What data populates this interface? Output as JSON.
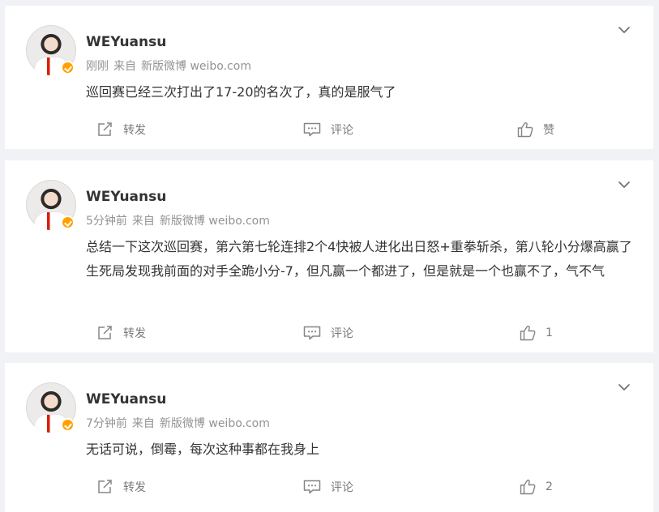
{
  "posts": [
    {
      "name": "WEYuansu",
      "time": "刚刚",
      "source_prefix": "来自",
      "source": "新版微博 weibo.com",
      "text": "巡回赛已经三次打出了17-20的名次了，真的是服气了",
      "repost_label": "转发",
      "comment_label": "评论",
      "like_label": "赞"
    },
    {
      "name": "WEYuansu",
      "time": "5分钟前",
      "source_prefix": "来自",
      "source": "新版微博 weibo.com",
      "text": "总结一下这次巡回赛，第六第七轮连排2个4快被人进化出日怒+重拳斩杀，第八轮小分爆高赢了生死局发现我前面的对手全跪小分-7，但凡赢一个都进了，但是就是一个也赢不了，气不气",
      "repost_label": "转发",
      "comment_label": "评论",
      "like_label": "1"
    },
    {
      "name": "WEYuansu",
      "time": "7分钟前",
      "source_prefix": "来自",
      "source": "新版微博 weibo.com",
      "text": "无话可说，倒霉，每次这种事都在我身上",
      "repost_label": "转发",
      "comment_label": "评论",
      "like_label": "2"
    }
  ],
  "icons": {
    "menu": "chevron-down-icon",
    "repost": "repost-icon",
    "comment": "comment-icon",
    "like": "thumbs-up-icon",
    "verified": "verified-badge-icon"
  },
  "colors": {
    "page_bg": "#f1f2f5",
    "card_bg": "#ffffff",
    "text": "#333333",
    "meta": "#939393",
    "verified": "#ffa200"
  }
}
